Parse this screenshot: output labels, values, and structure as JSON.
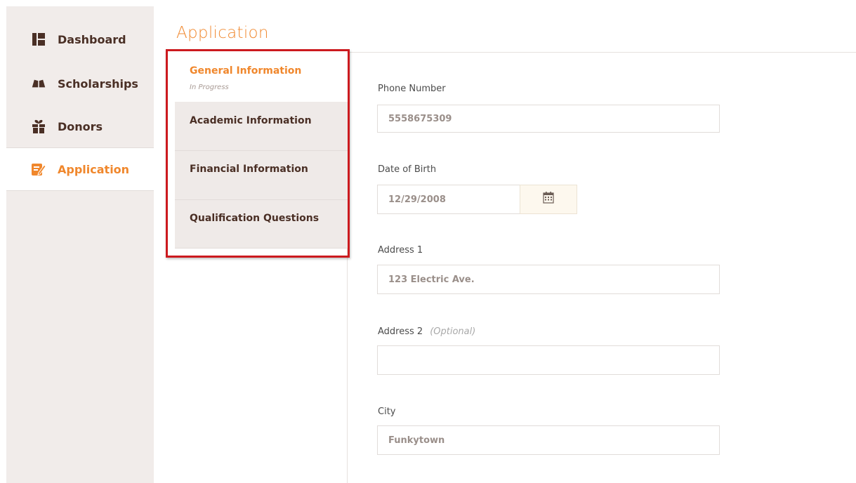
{
  "sidebar": {
    "items": [
      {
        "label": "Dashboard",
        "icon": "dashboard-icon"
      },
      {
        "label": "Scholarships",
        "icon": "book-icon"
      },
      {
        "label": "Donors",
        "icon": "gift-icon"
      },
      {
        "label": "Application",
        "icon": "edit-icon"
      }
    ],
    "active": "Application",
    "accent_color": "#f0872c",
    "text_color": "#4a2f25"
  },
  "header": {
    "title": "Application"
  },
  "steps": [
    {
      "title": "General Information",
      "status": "In Progress"
    },
    {
      "title": "Academic Information"
    },
    {
      "title": "Financial Information"
    },
    {
      "title": "Qualification Questions"
    }
  ],
  "highlight_color": "#cc1a1f",
  "form": {
    "phone": {
      "label": "Phone Number",
      "value": "5558675309"
    },
    "dob": {
      "label": "Date of Birth",
      "value": "12/29/2008",
      "icon": "calendar-icon"
    },
    "address1": {
      "label": "Address 1",
      "value": "123 Electric Ave."
    },
    "address2": {
      "label": "Address 2",
      "optional": "(Optional)",
      "value": ""
    },
    "city": {
      "label": "City",
      "value": "Funkytown"
    }
  }
}
